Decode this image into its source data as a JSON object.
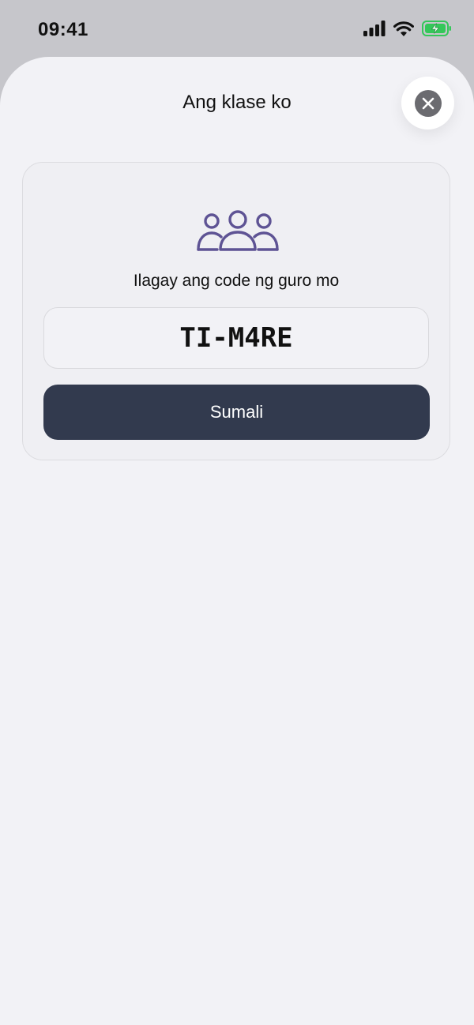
{
  "status_bar": {
    "time": "09:41",
    "icons": [
      "cellular-signal-icon",
      "wifi-icon",
      "battery-charging-icon"
    ]
  },
  "sheet": {
    "title": "Ang klase ko",
    "close_icon": "close-icon"
  },
  "join_card": {
    "icon": "people-group-icon",
    "prompt": "Ilagay ang code ng guro mo",
    "code_value": "TI-M4RE",
    "join_label": "Sumali"
  },
  "colors": {
    "accent": "#5e5394",
    "button_bg": "#323a4e",
    "battery_green": "#34c759"
  }
}
